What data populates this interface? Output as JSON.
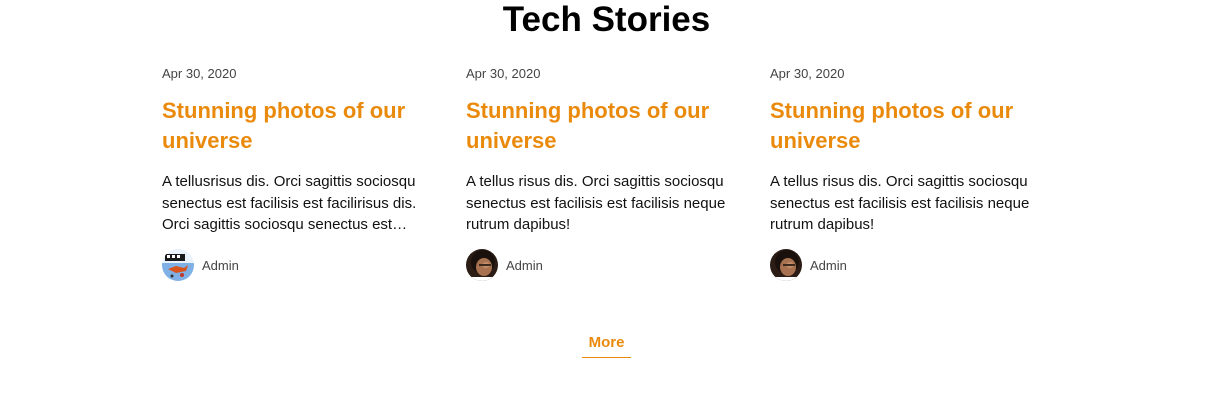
{
  "section": {
    "title": "Tech Stories"
  },
  "cards": [
    {
      "date": "Apr 30, 2020",
      "title": "Stunning photos of our universe",
      "excerpt": "A tellusrisus dis. Orci sagittis sociosqu senectus est facilisis est facilirisus dis. Orci sagittis sociosqu senectus est facilisis est facilisis neque rutrum dapibus!",
      "author": "Admin",
      "avatar_icon": "cartoon-avatar-icon"
    },
    {
      "date": "Apr 30, 2020",
      "title": "Stunning photos of our universe",
      "excerpt": "A tellus risus dis. Orci sagittis sociosqu senectus est facilisis est facilisis neque rutrum dapibus!",
      "author": "Admin",
      "avatar_icon": "person-photo-avatar-icon"
    },
    {
      "date": "Apr 30, 2020",
      "title": "Stunning photos of our universe",
      "excerpt": "A tellus risus dis. Orci sagittis sociosqu senectus est facilisis est facilisis neque rutrum dapibus!",
      "author": "Admin",
      "avatar_icon": "person-photo-avatar-icon"
    }
  ],
  "more": {
    "label": "More"
  },
  "colors": {
    "accent": "#ea8a0c",
    "text": "#111111",
    "muted": "#444444"
  }
}
